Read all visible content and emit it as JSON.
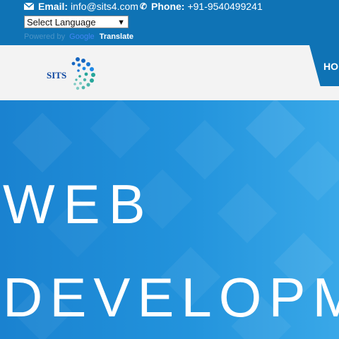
{
  "topbar": {
    "email_label": "Email:",
    "email_value": "info@sits4.com",
    "phone_label": "Phone:",
    "phone_value": "+91-9540499241",
    "language_select": "Select Language",
    "powered_by": "Powered by",
    "google": "Google",
    "translate": "Translate"
  },
  "logo": {
    "text": "SITS"
  },
  "nav": {
    "home_label": "HO"
  },
  "hero": {
    "line1": "WEB",
    "line2": "DEVELOPM"
  },
  "colors": {
    "topbar": "#0f73b5",
    "header": "#f3f3f3",
    "hero": "#1e88d6"
  }
}
